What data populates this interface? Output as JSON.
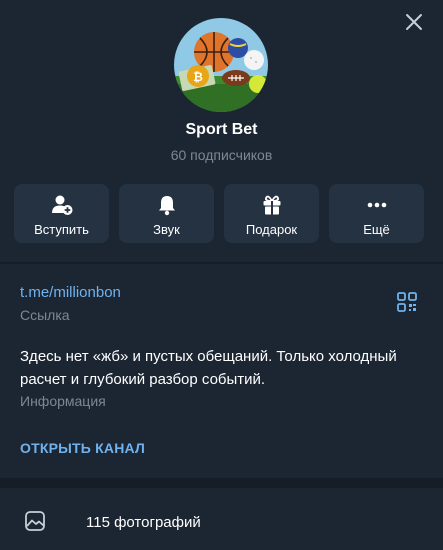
{
  "channel": {
    "title": "Sport Bet",
    "subscribers": "60 подписчиков"
  },
  "actions": [
    {
      "label": "Вступить",
      "icon": "join-user-icon"
    },
    {
      "label": "Звук",
      "icon": "bell-icon"
    },
    {
      "label": "Подарок",
      "icon": "gift-icon"
    },
    {
      "label": "Ещё",
      "icon": "more-dots-icon"
    }
  ],
  "info": {
    "link": "t.me/millionbon",
    "link_label": "Ссылка",
    "description": "Здесь нет «жб» и пустых обещаний. Только холодный расчет и глубокий разбор событий.",
    "description_label": "Информация",
    "open_button": "ОТКРЫТЬ КАНАЛ"
  },
  "media": {
    "photos": "115 фотографий"
  },
  "colors": {
    "background": "#1c2632",
    "button_bg": "#243241",
    "accent": "#6fb2ee",
    "muted": "#7b8896"
  }
}
